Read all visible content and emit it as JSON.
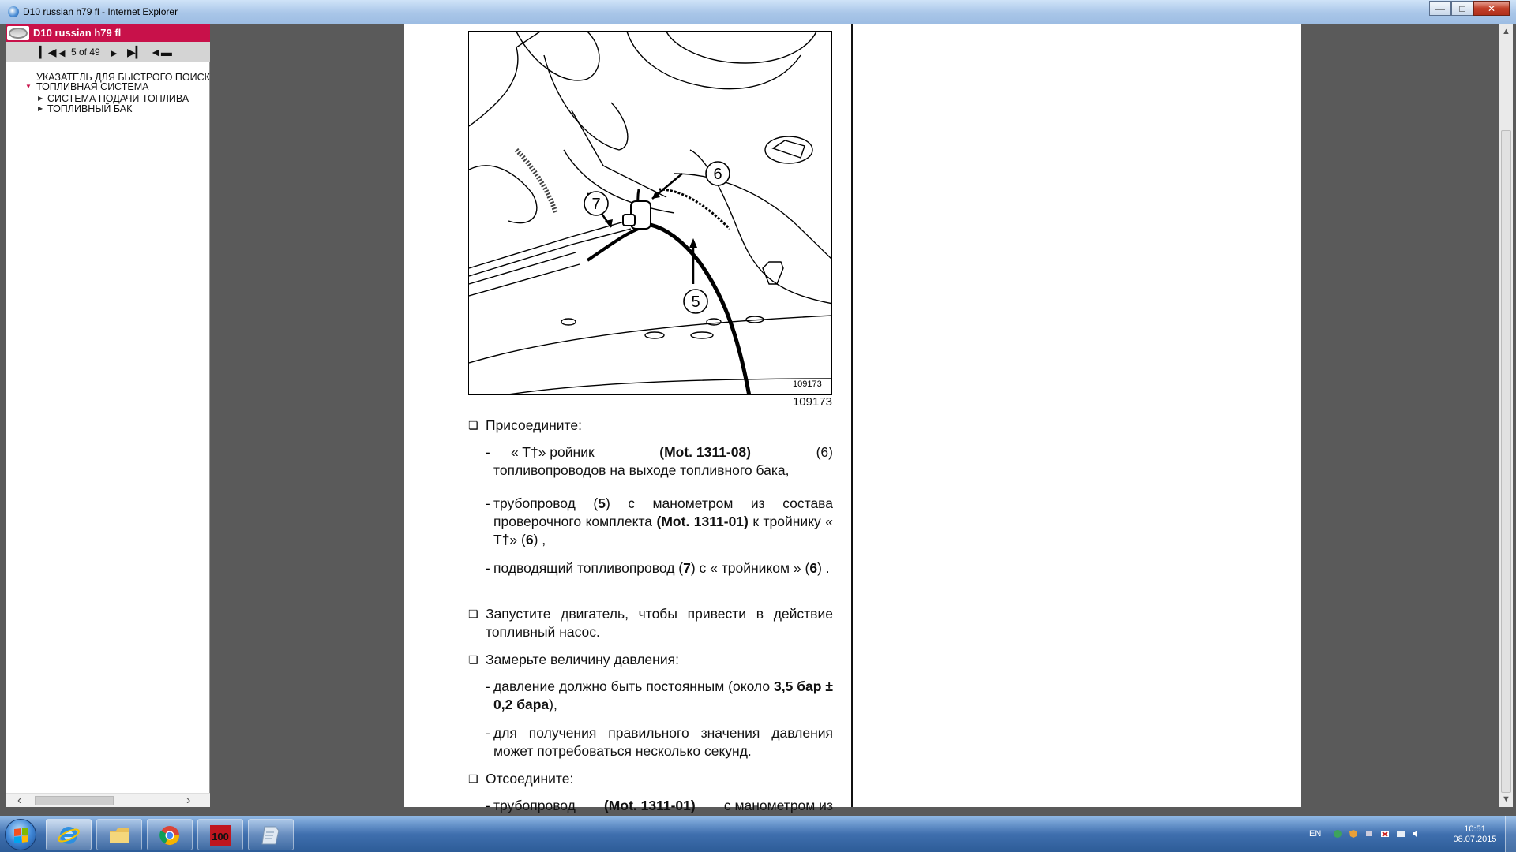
{
  "window": {
    "title": "D10 russian h79 fl - Internet Explorer"
  },
  "nav": {
    "doc_title": "D10 russian h79 fl",
    "pager": {
      "page_text": "5 of 49"
    },
    "tree": [
      {
        "label": "УКАЗАТЕЛЬ ДЛЯ БЫСТРОГО ПОИСК",
        "level": 0,
        "expanded": false
      },
      {
        "label": "ТОПЛИВНАЯ СИСТЕМА",
        "level": 0,
        "expanded": true
      },
      {
        "label": "СИСТЕМА ПОДАЧИ ТОПЛИВА",
        "level": 1,
        "expanded": false
      },
      {
        "label": "ТОПЛИВНЫЙ БАК",
        "level": 1,
        "expanded": false
      }
    ]
  },
  "figure": {
    "callouts": [
      "6",
      "7",
      "5"
    ],
    "inner_code": "109173",
    "caption": "109173"
  },
  "content": {
    "p1": "Присоедините:",
    "p1_items": [
      {
        "a": "« T†» ройник",
        "b": "(Mot. 1311-08)",
        "c": "(6)",
        "d": "топливопроводов на выходе топливного бака,"
      },
      {
        "a": "трубопровод (",
        "b": "5",
        "c": ") с манометром из состава проверочного комплекта",
        "d": "(Mot. 1311-01)",
        "e": "к тройнику « T†» (",
        "f": "6",
        "g": ") ,"
      },
      {
        "a": "подводящий топливопровод (",
        "b": "7",
        "c": ") с « тройником » (",
        "d": "6",
        "e": ") ."
      }
    ],
    "p2": "Запустите двигатель, чтобы привести в действие топливный насос.",
    "p3": "Замерьте величину давления:",
    "p3_items": [
      {
        "a": "давление должно быть постоянным (около",
        "b": "3,5 бар ± 0,2 бара",
        "c": "),"
      },
      {
        "a": "для получения правильного значения давления может потребоваться несколько секунд."
      }
    ],
    "p4": "Отсоедините:",
    "p4_items": [
      {
        "a": "трубопровод",
        "b": "(Mot. 1311-01)",
        "c": "с манометром из"
      }
    ]
  },
  "taskbar": {
    "apps": [
      {
        "name": "internet-explorer",
        "active": true
      },
      {
        "name": "file-explorer",
        "active": false
      },
      {
        "name": "chrome",
        "active": false
      },
      {
        "name": "app-100",
        "label": "100",
        "active": false
      },
      {
        "name": "document-app",
        "active": false
      }
    ],
    "lang": "EN",
    "time": "10:51",
    "date": "08.07.2015"
  }
}
